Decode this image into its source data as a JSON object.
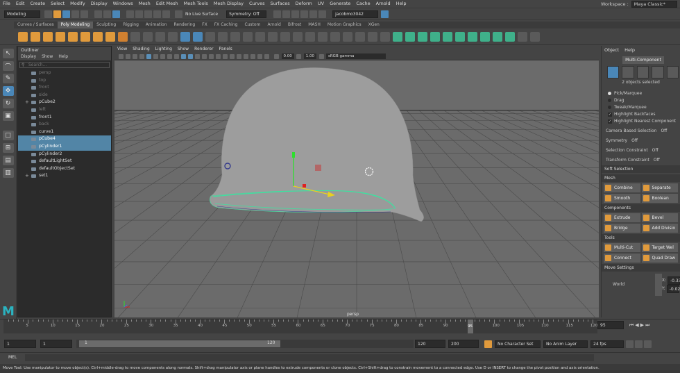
{
  "menubar": [
    "File",
    "Edit",
    "Create",
    "Select",
    "Modify",
    "Display",
    "Windows",
    "Mesh",
    "Edit Mesh",
    "Mesh Tools",
    "Mesh Display",
    "Curves",
    "Surfaces",
    "Deform",
    "UV",
    "Generate",
    "Cache",
    "Arnold",
    "Help"
  ],
  "workspace": {
    "label": "Workspace :",
    "value": "Maya Classic*"
  },
  "statusline": {
    "mode": "Modeling",
    "live_surface": "No Live Surface",
    "symmetry": "Symmetry: Off",
    "user": "jacobmo3042"
  },
  "shelf_tabs": [
    "Curves / Surfaces",
    "Poly Modeling",
    "Sculpting",
    "Rigging",
    "Animation",
    "Rendering",
    "FX",
    "FX Caching",
    "Custom",
    "Arnold",
    "Bifrost",
    "MASH",
    "Motion Graphics",
    "XGen"
  ],
  "shelf_active": "Poly Modeling",
  "outliner": {
    "title": "Outliner",
    "menu": [
      "Display",
      "Show",
      "Help"
    ],
    "search_placeholder": "Search...",
    "items": [
      {
        "label": "persp",
        "state": "dim"
      },
      {
        "label": "top",
        "state": "dim"
      },
      {
        "label": "front",
        "state": "dim"
      },
      {
        "label": "side",
        "state": "dim"
      },
      {
        "label": "pCube2",
        "state": "normal",
        "expand": "+"
      },
      {
        "label": "left",
        "state": "dim"
      },
      {
        "label": "front1",
        "state": "normal"
      },
      {
        "label": "back",
        "state": "dim"
      },
      {
        "label": "curve1",
        "state": "normal"
      },
      {
        "label": "pCube4",
        "state": "sel"
      },
      {
        "label": "pCylinder1",
        "state": "sel"
      },
      {
        "label": "pCylinder2",
        "state": "normal"
      },
      {
        "label": "defaultLightSet",
        "state": "normal"
      },
      {
        "label": "defaultObjectSet",
        "state": "normal"
      },
      {
        "label": "set1",
        "state": "normal",
        "expand": "+"
      }
    ]
  },
  "viewport": {
    "menu": [
      "View",
      "Shading",
      "Lighting",
      "Show",
      "Renderer",
      "Panels"
    ],
    "field1": "0.00",
    "field2": "1.00",
    "colorspace": "sRGB gamma",
    "camera": "persp"
  },
  "right_panel": {
    "menu": [
      "Object",
      "Help"
    ],
    "mode": "Multi-Component",
    "selected_count": "2 objects selected",
    "radios": [
      {
        "label": "Pick/Marquee",
        "on": true
      },
      {
        "label": "Drag",
        "on": false
      },
      {
        "label": "Tweak/Marquee",
        "on": false
      }
    ],
    "checks": [
      {
        "label": "Highlight Backfaces",
        "on": true
      },
      {
        "label": "Highlight Nearest Component",
        "on": true
      }
    ],
    "options": [
      {
        "label": "Camera Based Selection",
        "value": "Off"
      },
      {
        "label": "Symmetry",
        "value": "Off"
      },
      {
        "label": "Selection Constraint",
        "value": "Off"
      },
      {
        "label": "Transform Constraint",
        "value": "Off"
      }
    ],
    "soft_selection": "Soft Selection",
    "sections": [
      {
        "title": "Mesh",
        "buttons": [
          [
            "Combine",
            "Separate"
          ],
          [
            "Smooth",
            "Boolean"
          ]
        ]
      },
      {
        "title": "Components",
        "buttons": [
          [
            "Extrude",
            "Bevel"
          ],
          [
            "Bridge",
            "Add Divisio"
          ]
        ]
      },
      {
        "title": "Tools",
        "buttons": [
          [
            "Multi-Cut",
            "Target Wel"
          ],
          [
            "Connect",
            "Quad Draw"
          ]
        ]
      }
    ],
    "move_settings": {
      "title": "Move Settings",
      "space": "World",
      "x_label": "X:",
      "x": "-0.33",
      "y_label": "Y:",
      "y": "-0.02"
    }
  },
  "timeline": {
    "ticks": [
      "5",
      "10",
      "15",
      "20",
      "25",
      "30",
      "35",
      "40",
      "45",
      "50",
      "55",
      "60",
      "65",
      "70",
      "75",
      "80",
      "85",
      "90",
      "95",
      "100",
      "105",
      "110",
      "115",
      "120"
    ],
    "current_frame": "95",
    "current_field": "95"
  },
  "range": {
    "start": "1",
    "start2": "1",
    "slider_start": "1",
    "slider_end": "120",
    "end": "120",
    "end2": "200",
    "character_set": "No Character Set",
    "anim_layer": "No Anim Layer",
    "fps": "24 fps"
  },
  "mel_label": "MEL",
  "help_line": "Move Tool: Use manipulator to move object(s). Ctrl+middle-drag to move components along normals. Shift+drag manipulator axis or plane handles to extrude components or clone objects. Ctrl+Shift+drag to constrain movement to a connected edge. Use D or INSERT to change the pivot position and axis orientation.",
  "colors": {
    "selection": "#5285a6",
    "accent": "#e09a3c",
    "maya_logo": "#2bb3c0",
    "green_wire": "#3fe0a0",
    "yellow_arrow": "#e8d020"
  }
}
